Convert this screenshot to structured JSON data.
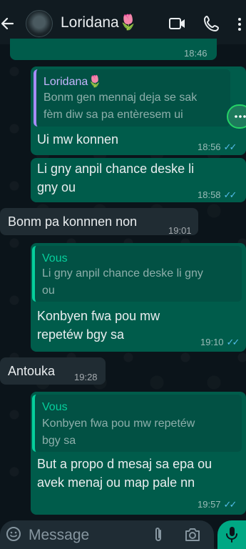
{
  "header": {
    "contact_name": "Loridana🌷",
    "icons": [
      "back-arrow-icon",
      "video-call-icon",
      "phone-icon",
      "more-vert-icon"
    ]
  },
  "messages": [
    {
      "direction": "outgoing",
      "time": "18:46",
      "partial": true
    },
    {
      "direction": "outgoing",
      "quote": {
        "author": "Loridana🌷",
        "text_line1": "Bonm gen mennaj deja se sak",
        "text_line2": "fèm diw sa pa entèresem ui"
      },
      "text": "Ui mw konnen",
      "time": "18:56",
      "ticks": "✓✓"
    },
    {
      "direction": "outgoing",
      "text_line1": "Li gny anpil chance deske li",
      "text_line2": "gny ou",
      "time": "18:58",
      "ticks": "✓✓"
    },
    {
      "direction": "incoming",
      "text": "Bonm pa konnnen non",
      "time": "19:01"
    },
    {
      "direction": "outgoing",
      "quote": {
        "author": "Vous",
        "text_line1": "Li gny anpil chance deske li gny",
        "text_line2": "ou"
      },
      "text_line1": "Konbyen fwa pou mw",
      "text_line2": "repetéw bgy sa",
      "time": "19:10",
      "ticks": "✓✓"
    },
    {
      "direction": "incoming",
      "text": "Antouka",
      "time": "19:28"
    },
    {
      "direction": "outgoing",
      "quote": {
        "author": "Vous",
        "text_line1": "Konbyen fwa pou mw repetéw",
        "text_line2": "bgy sa"
      },
      "text_line1": "But a propo d mesaj sa epa ou",
      "text_line2": "avek menaj ou map pale nn",
      "time": "19:57",
      "ticks": "✓✓"
    }
  ],
  "input": {
    "placeholder": "Message"
  },
  "colors": {
    "outgoing_bubble": "#005c4b",
    "incoming_bubble": "#202c33",
    "accent": "#00a884",
    "read_ticks": "#53bdeb"
  }
}
